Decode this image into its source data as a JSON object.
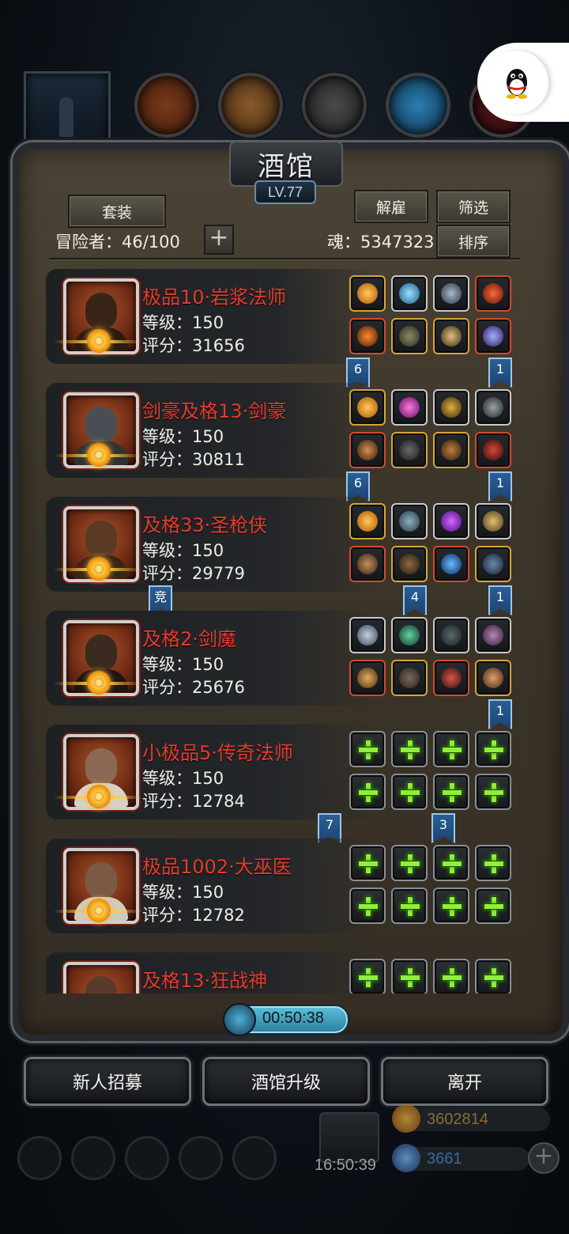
{
  "title": "酒馆",
  "level": "LV.77",
  "buttons": {
    "suit": "套装",
    "dismiss": "解雇",
    "filter": "筛选",
    "sort": "排序"
  },
  "adventurers": "冒险者：46/100",
  "soul": "魂：5347323",
  "heroes": [
    {
      "name": "极品10·岩浆法师",
      "level": "等级：150",
      "score": "评分：31656"
    },
    {
      "name": "剑豪及格13·剑豪",
      "level": "等级：150",
      "score": "评分：30811"
    },
    {
      "name": "及格33·圣枪侠",
      "level": "等级：150",
      "score": "评分：29779"
    },
    {
      "name": "及格2·剑魔",
      "level": "等级：150",
      "score": "评分：25676"
    },
    {
      "name": "小极品5·传奇法师",
      "level": "等级：150",
      "score": "评分：12784"
    },
    {
      "name": "极品1002·大巫医",
      "level": "等级：150",
      "score": "评分：12782"
    },
    {
      "name": "及格13·狂战神",
      "level": "",
      "score": ""
    }
  ],
  "flags": {
    "f1": "6",
    "f2": "1",
    "f3": "6",
    "f4": "1",
    "f5": "竞",
    "f6": "4",
    "f7": "1",
    "f8": "1",
    "f9": "7",
    "f10": "3"
  },
  "timer": "00:50:38",
  "bottom": {
    "recruit": "新人招募",
    "upgrade": "酒馆升级",
    "leave": "离开"
  },
  "hud": {
    "time": "16:50:39",
    "gold": "3602814",
    "gems": "3661"
  },
  "colors": {
    "hero_name": "#e53c2c",
    "slot_plus": "#8ff03a",
    "flag_blue": "#2a5f95"
  }
}
